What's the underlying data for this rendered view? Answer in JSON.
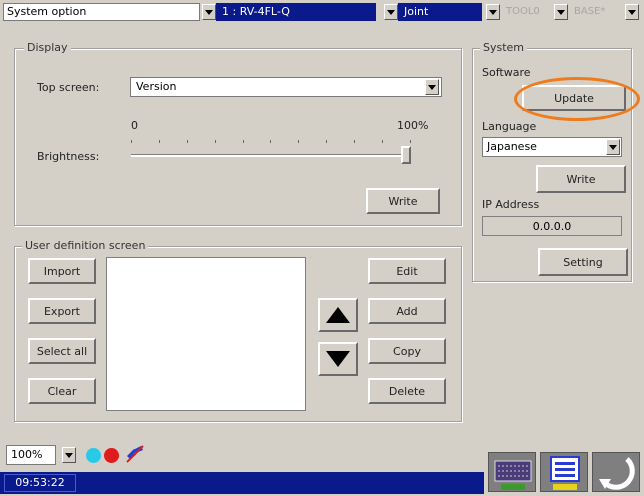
{
  "topbar": {
    "mode_select": "System option",
    "robot_select": "1 : RV-4FL-Q",
    "jog_select": "Joint",
    "tool_select": "TOOL0",
    "base_select": "BASE*"
  },
  "display": {
    "group_title": "Display",
    "top_screen_label": "Top screen:",
    "top_screen_value": "Version",
    "brightness_min": "0",
    "brightness_max": "100%",
    "brightness_label": "Brightness:",
    "brightness_level": 1.0,
    "write_label": "Write"
  },
  "user_def": {
    "group_title": "User definition screen",
    "import_label": "Import",
    "export_label": "Export",
    "select_all_label": "Select all",
    "clear_label": "Clear",
    "edit_label": "Edit",
    "add_label": "Add",
    "copy_label": "Copy",
    "delete_label": "Delete"
  },
  "system": {
    "group_title": "System",
    "software_label": "Software",
    "update_label": "Update",
    "language_label": "Language",
    "language_value": "Japanese",
    "write_label": "Write",
    "ip_label": "IP Address",
    "ip_value": "0.0.0.0",
    "setting_label": "Setting"
  },
  "bottom": {
    "zoom_value": "100%",
    "time": "09:53:22",
    "status_colors": {
      "cyan": "#29c9e8",
      "red": "#e01b1b",
      "blue": "#2a3cd0"
    }
  },
  "icons": [
    "chevron-down-icon",
    "up-arrow-icon",
    "down-arrow-icon",
    "keyboard-icon",
    "menu-icon",
    "return-icon"
  ]
}
